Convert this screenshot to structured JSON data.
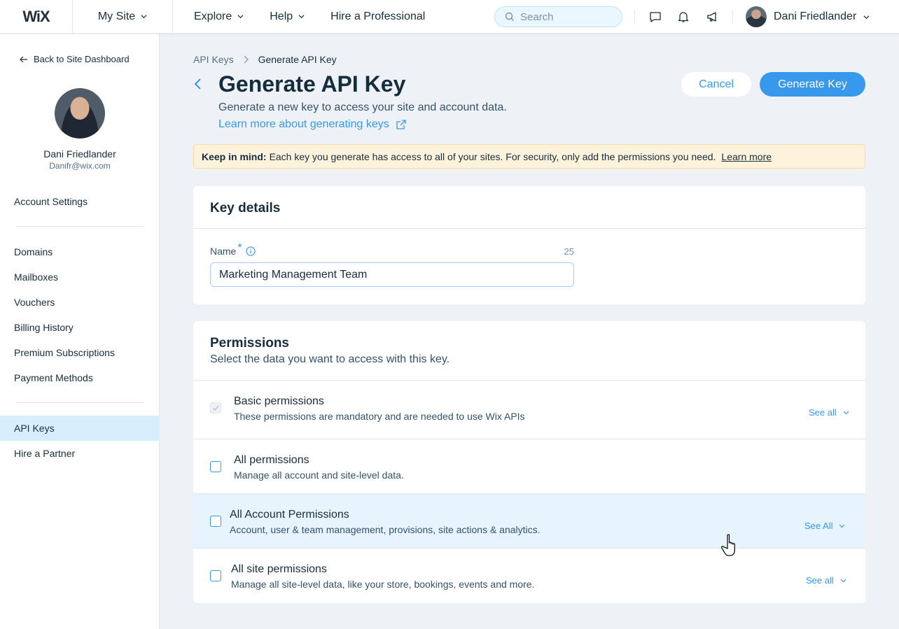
{
  "topbar": {
    "logo": "WiX",
    "site_selector": "My Site",
    "nav": [
      {
        "label": "Explore",
        "has_dropdown": true
      },
      {
        "label": "Help",
        "has_dropdown": true
      },
      {
        "label": "Hire a Professional",
        "has_dropdown": false
      }
    ],
    "search_placeholder": "Search",
    "user_name": "Dani Friedlander"
  },
  "sidebar": {
    "back_label": "Back to Site Dashboard",
    "profile_name": "Dani Friedlander",
    "profile_email": "Danifr@wix.com",
    "account_settings": "Account Settings",
    "items": [
      "Domains",
      "Mailboxes",
      "Vouchers",
      "Billing History",
      "Premium Subscriptions",
      "Payment Methods"
    ],
    "api_keys": "API Keys",
    "hire_partner": "Hire a Partner"
  },
  "breadcrumb": {
    "parent": "API Keys",
    "current": "Generate API Key"
  },
  "header": {
    "title": "Generate API Key",
    "subtitle": "Generate a new key to access your site and account data.",
    "learn_link": "Learn more about generating keys",
    "cancel": "Cancel",
    "generate": "Generate Key"
  },
  "notice": {
    "bold": "Keep in mind:",
    "text": "Each key you generate has access to all of your sites. For security, only add the permissions you need.",
    "link": "Learn more"
  },
  "key_details": {
    "title": "Key details",
    "name_label": "Name",
    "required_mark": "*",
    "char_count": "25",
    "name_value": "Marketing Management Team"
  },
  "permissions": {
    "title": "Permissions",
    "description": "Select the data you want to access with this key.",
    "rows": [
      {
        "title": "Basic permissions",
        "desc": "These permissions are mandatory and are needed to use Wix APIs",
        "see": "See all"
      },
      {
        "title": "All permissions",
        "desc": "Manage all account and site-level data.",
        "see": ""
      },
      {
        "title": "All Account Permissions",
        "desc": "Account, user & team management, provisions, site actions & analytics.",
        "see": "See All"
      },
      {
        "title": "All site permissions",
        "desc": "Manage all site-level data, like your store, bookings, events and more.",
        "see": "See all"
      }
    ]
  },
  "colors": {
    "accent": "#3899ec",
    "active_nav": "#d6eefe",
    "notice_bg": "#fdf3dc",
    "hover_row": "#e7f4fd"
  }
}
